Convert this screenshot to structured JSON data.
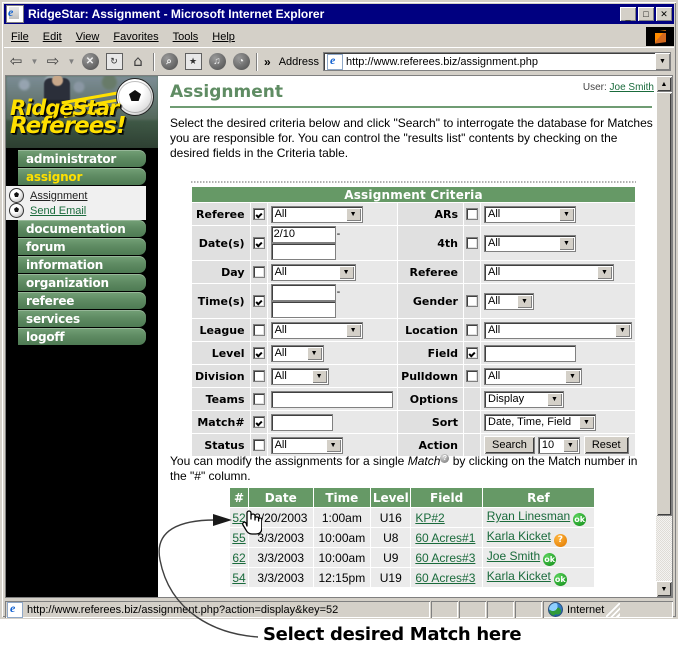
{
  "window": {
    "title": "RidgeStar: Assignment - Microsoft Internet Explorer",
    "minimize_label": "_",
    "maximize_label": "□",
    "close_label": "✕"
  },
  "menubar": {
    "items": [
      "File",
      "Edit",
      "View",
      "Favorites",
      "Tools",
      "Help"
    ]
  },
  "toolbar": {
    "back_label": "⇦",
    "forward_label": "⇨",
    "stop_label": "✕",
    "refresh_label": "↻",
    "home_label": "⌂",
    "search_label": "⌕",
    "favorites_label": "★",
    "media_label": "♫",
    "history_label": "◔",
    "more_label": "»",
    "address_label": "Address",
    "url": "http://www.referees.biz/assignment.php"
  },
  "sidebar": {
    "logo_line1": "RidgeStar",
    "logo_line2": "Referees!",
    "items": [
      {
        "label": "administrator",
        "active": false
      },
      {
        "label": "assignor",
        "active": true
      }
    ],
    "subitems": [
      {
        "label": "Assignment",
        "current": true
      },
      {
        "label": "Send Email",
        "current": false
      }
    ],
    "items2": [
      {
        "label": "documentation"
      },
      {
        "label": "forum"
      },
      {
        "label": "information"
      },
      {
        "label": "organization"
      },
      {
        "label": "referee"
      },
      {
        "label": "services"
      },
      {
        "label": "logoff"
      }
    ]
  },
  "page": {
    "title": "Assignment",
    "user_label": "User:",
    "user_name": "Joe Smith",
    "intro": "Select the desired criteria below and click \"Search\" to interrogate the database for Matches you are responsible for. You can control the \"results list\" contents by checking on the desired fields in the Criteria table.",
    "results_intro_a": "You can modify the assignments for a single ",
    "results_intro_em": "Match",
    "results_intro_b": " by clicking on the Match number in the \"#\" column."
  },
  "criteria": {
    "caption": "Assignment Criteria",
    "rows": [
      {
        "left_label": "Referee",
        "left_checked": true,
        "left_type": "select",
        "left_value": "All",
        "left_width": 92,
        "right_label": "ARs",
        "right_checked": false,
        "right_type": "select",
        "right_value": "All",
        "right_width": 92
      },
      {
        "left_label": "Date(s)",
        "left_checked": true,
        "left_type": "range",
        "left_value": "2/10",
        "left_value2": "",
        "left_width": 65,
        "right_label": "4th",
        "right_checked": false,
        "right_type": "select",
        "right_value": "All",
        "right_width": 92
      },
      {
        "left_label": "Day",
        "left_checked": false,
        "left_type": "select",
        "left_value": "All",
        "left_width": 85,
        "right_label": "Referee",
        "right_checked": null,
        "right_type": "select",
        "right_value": "All",
        "right_width": 130
      },
      {
        "left_label": "Time(s)",
        "left_checked": true,
        "left_type": "range",
        "left_value": "",
        "left_value2": "",
        "left_width": 65,
        "right_label": "Gender",
        "right_checked": false,
        "right_type": "select",
        "right_value": "All",
        "right_width": 50
      },
      {
        "left_label": "League",
        "left_checked": false,
        "left_type": "select",
        "left_value": "All",
        "left_width": 92,
        "right_label": "Location",
        "right_checked": false,
        "right_type": "select",
        "right_value": "All",
        "right_width": 148
      },
      {
        "left_label": "Level",
        "left_checked": true,
        "left_type": "select",
        "left_value": "All",
        "left_width": 53,
        "right_label": "Field",
        "right_checked": true,
        "right_type": "text",
        "right_value": "",
        "right_width": 92
      },
      {
        "left_label": "Division",
        "left_checked": false,
        "left_type": "select",
        "left_value": "All",
        "left_width": 58,
        "right_label": "Pulldown",
        "right_checked": false,
        "right_type": "select",
        "right_value": "All",
        "right_width": 98
      },
      {
        "left_label": "Teams",
        "left_checked": false,
        "left_type": "text",
        "left_value": "",
        "left_width": 122,
        "right_label": "Options",
        "right_checked": null,
        "right_type": "select",
        "right_value": "Display",
        "right_width": 80
      },
      {
        "left_label": "Match#",
        "left_checked": true,
        "left_type": "text",
        "left_value": "",
        "left_width": 62,
        "right_label": "Sort",
        "right_checked": null,
        "right_type": "select",
        "right_value": "Date, Time, Field",
        "right_width": 112
      },
      {
        "left_label": "Status",
        "left_checked": false,
        "left_type": "select",
        "left_value": "All",
        "left_width": 72,
        "right_label": "Action",
        "right_checked": null,
        "right_type": "action",
        "right_value": "",
        "right_width": 0
      }
    ],
    "action": {
      "search_label": "Search",
      "count_value": "10",
      "reset_label": "Reset"
    }
  },
  "results": {
    "columns": [
      "#",
      "Date",
      "Time",
      "Level",
      "Field",
      "Ref"
    ],
    "rows": [
      {
        "num": "52",
        "date": "2/20/2003",
        "time": "1:00am",
        "level": "U16",
        "field": "KP#2",
        "ref": "Ryan Linesman",
        "status": "ok"
      },
      {
        "num": "55",
        "date": "3/3/2003",
        "time": "10:00am",
        "level": "U8",
        "field": "60 Acres#1",
        "ref": "Karla Kicket",
        "status": "question"
      },
      {
        "num": "62",
        "date": "3/3/2003",
        "time": "10:00am",
        "level": "U9",
        "field": "60 Acres#3",
        "ref": "Joe Smith",
        "status": "ok"
      },
      {
        "num": "54",
        "date": "3/3/2003",
        "time": "12:15pm",
        "level": "U19",
        "field": "60 Acres#3",
        "ref": "Karla Kicket",
        "status": "ok"
      }
    ],
    "ok_badge": "ok",
    "question_badge": "?"
  },
  "statusbar": {
    "url": "http://www.referees.biz/assignment.php?action=display&key=52",
    "zone": "Internet"
  },
  "annotation": {
    "text": "Select desired Match here"
  },
  "colors": {
    "green_header": "#669966",
    "nav_green": "#5f8c63",
    "link_green": "#1a6b3c",
    "logo_yellow": "#ffe000",
    "title_blue": "#000080",
    "ok_green": "#0d8a16",
    "question_orange": "#e07800"
  }
}
